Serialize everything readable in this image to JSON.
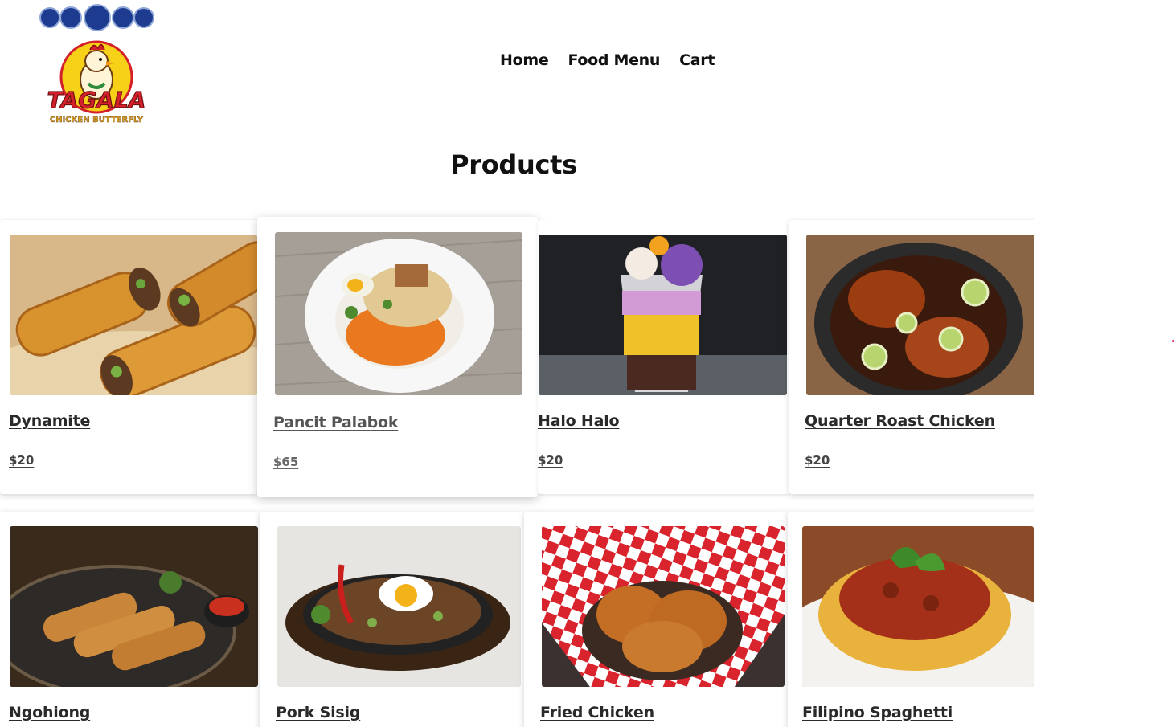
{
  "header": {
    "logo": {
      "brand_text": "TAGALA",
      "sub_text": "CHICKEN BUTTERFLY",
      "icon": "rooster-mascot-icon",
      "badges": [
        "Best",
        "CEBU",
        "BEST CEBU 2020",
        "CEBU",
        "Best"
      ]
    },
    "nav": [
      {
        "label": "Home"
      },
      {
        "label": "Food Menu"
      },
      {
        "label": "Cart"
      }
    ]
  },
  "main": {
    "title": "Products",
    "products": [
      {
        "name": "Dynamite",
        "price": "$20",
        "image": "dynamite-lumpia-image"
      },
      {
        "name": "Pancit Palabok",
        "price": "$65",
        "image": "pancit-palabok-image"
      },
      {
        "name": "Halo Halo",
        "price": "$20",
        "image": "halo-halo-image"
      },
      {
        "name": "Quarter Roast Chicken",
        "price": "$20",
        "image": "roast-chicken-image"
      },
      {
        "name": "Ngohiong",
        "price": "",
        "image": "ngohiong-image"
      },
      {
        "name": "Pork Sisig",
        "price": "",
        "image": "pork-sisig-image"
      },
      {
        "name": "Fried Chicken",
        "price": "",
        "image": "fried-chicken-image"
      },
      {
        "name": "Filipino Spaghetti",
        "price": "",
        "image": "filipino-spaghetti-image"
      }
    ]
  },
  "colors": {
    "text": "#111111",
    "accent_dot": "#e0245e",
    "logo_red": "#d3202a",
    "logo_yellow": "#f7d117",
    "badge_blue": "#1d3c8f"
  }
}
